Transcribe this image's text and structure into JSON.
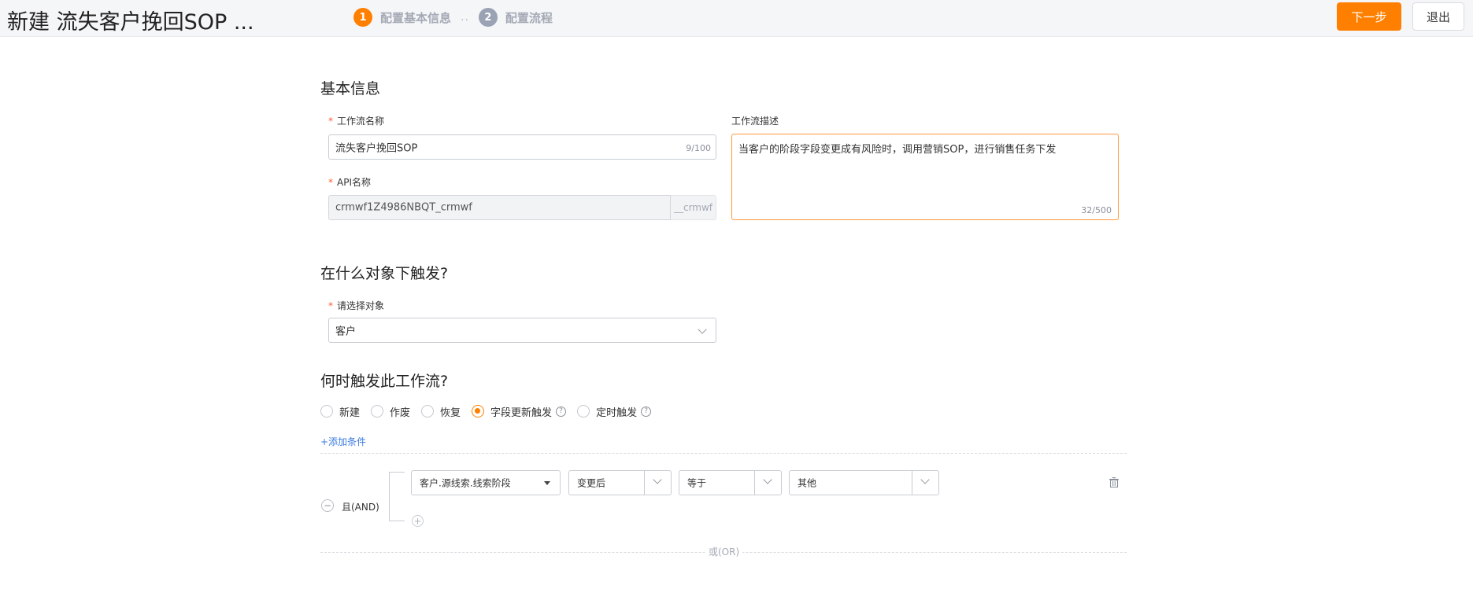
{
  "header": {
    "title": "新建 流失客户挽回SOP ...",
    "steps": [
      {
        "num": "1",
        "label": "配置基本信息"
      },
      {
        "num": "2",
        "label": "配置流程"
      }
    ],
    "step_separator": "..",
    "next_label": "下一步",
    "exit_label": "退出"
  },
  "basic": {
    "title": "基本信息",
    "name_label": "工作流名称",
    "name_value": "流失客户挽回SOP",
    "name_count": "9/100",
    "api_label": "API名称",
    "api_value": "crmwf1Z4986NBQT_crmwf",
    "api_suffix": "__crmwf",
    "desc_label": "工作流描述",
    "desc_value": "当客户的阶段字段变更成有风险时，调用营销SOP，进行销售任务下发",
    "desc_count": "32/500"
  },
  "object": {
    "title": "在什么对象下触发?",
    "label": "请选择对象",
    "value": "客户"
  },
  "trigger": {
    "title": "何时触发此工作流?",
    "options": [
      "新建",
      "作废",
      "恢复",
      "字段更新触发",
      "定时触发"
    ],
    "selected": "字段更新触发",
    "add_condition": "+添加条件",
    "and_label": "且(AND)",
    "or_label": "或(OR)",
    "condition": {
      "field": "客户.源线索.线索阶段",
      "timing": "变更后",
      "operator": "等于",
      "value": "其他"
    }
  },
  "colors": {
    "accent": "#ff8000",
    "link": "#3a7be0",
    "required": "#ff5a34"
  }
}
